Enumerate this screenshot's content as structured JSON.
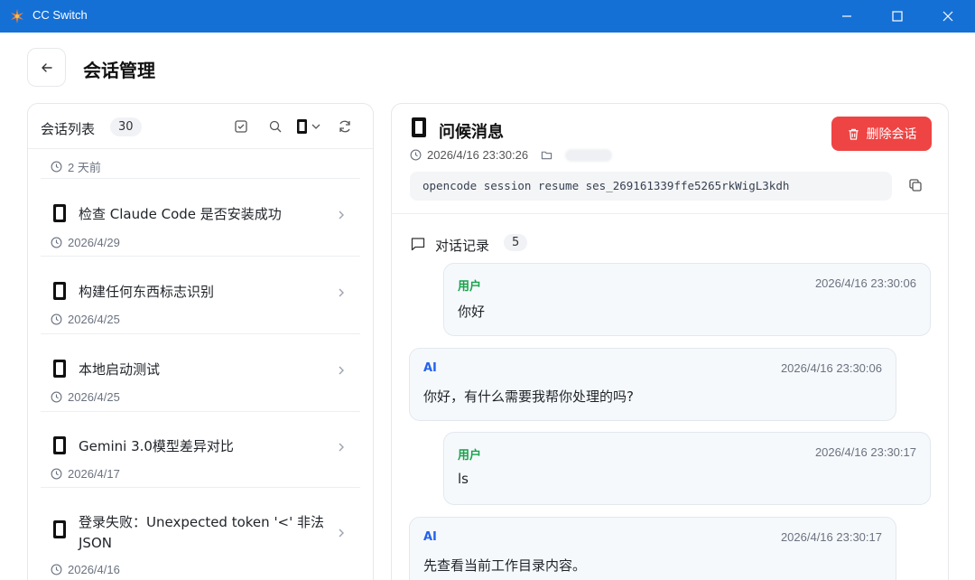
{
  "window": {
    "title": "CC Switch",
    "logo_icon": "cc-switch-logo-icon",
    "accent": "#1570d6"
  },
  "header": {
    "back_icon": "arrow-left-icon",
    "title": "会话管理"
  },
  "session_list": {
    "title": "会话列表",
    "count": "30",
    "top_time": "2 天前",
    "items": [
      {
        "title": "检查 Claude Code 是否安装成功",
        "date": "2026/4/29"
      },
      {
        "title": "构建任何东西标志识别",
        "date": "2026/4/25"
      },
      {
        "title": "本地启动测试",
        "date": "2026/4/25"
      },
      {
        "title": "Gemini 3.0模型差异对比",
        "date": "2026/4/17"
      },
      {
        "title": "登录失败：Unexpected token '<' 非法 JSON",
        "date": "2026/4/16"
      }
    ]
  },
  "session_detail": {
    "title": "问候消息",
    "timestamp": "2026/4/16 23:30:26",
    "delete_label": "删除会话",
    "delete_color": "#ef4444",
    "command": "opencode session resume ses_269161339ffe5265rkWigL3kdh",
    "conversation_title": "对话记录",
    "conversation_count": "5",
    "messages": [
      {
        "role": "用户",
        "time": "2026/4/16 23:30:06",
        "text": "你好"
      },
      {
        "role": "AI",
        "time": "2026/4/16 23:30:06",
        "text": "你好，有什么需要我帮你处理的吗?"
      },
      {
        "role": "用户",
        "time": "2026/4/16 23:30:17",
        "text": "ls"
      },
      {
        "role": "AI",
        "time": "2026/4/16 23:30:17",
        "text": "先查看当前工作目录内容。"
      }
    ]
  }
}
